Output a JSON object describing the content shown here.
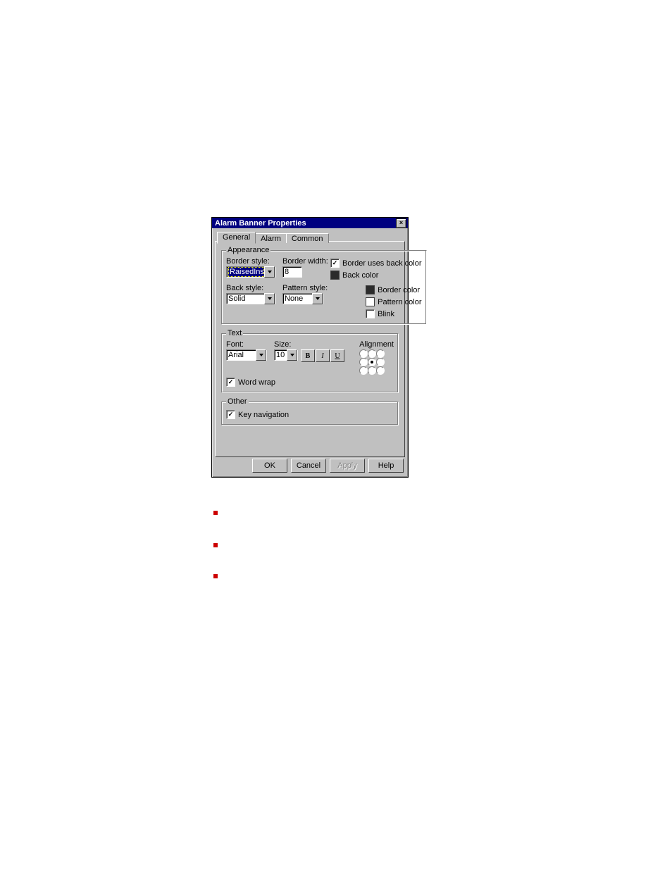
{
  "dialog": {
    "title": "Alarm Banner Properties",
    "tabs": [
      "General",
      "Alarm",
      "Common"
    ],
    "active_tab": 0
  },
  "appearance": {
    "legend": "Appearance",
    "border_style_label": "Border style:",
    "border_style_value": "RaisedInset",
    "border_width_label": "Border width:",
    "border_width_value": "8",
    "back_style_label": "Back style:",
    "back_style_value": "Solid",
    "pattern_style_label": "Pattern style:",
    "pattern_style_value": "None",
    "border_uses_back_label": "Border uses back color",
    "border_uses_back_checked": true,
    "back_color_label": "Back color",
    "back_color": "#2b2b2b",
    "border_color_label": "Border color",
    "border_color": "#2b2b2b",
    "pattern_color_label": "Pattern color",
    "pattern_color": "#ffffff",
    "blink_label": "Blink",
    "blink_checked": false
  },
  "text": {
    "legend": "Text",
    "font_label": "Font:",
    "font_value": "Arial",
    "size_label": "Size:",
    "size_value": "10",
    "bold_glyph": "B",
    "italic_glyph": "I",
    "underline_glyph": "U",
    "wordwrap_label": "Word wrap",
    "wordwrap_checked": true,
    "alignment_label": "Alignment",
    "alignment_selected": 4
  },
  "other": {
    "legend": "Other",
    "keynav_label": "Key navigation",
    "keynav_checked": true
  },
  "buttons": {
    "ok": "OK",
    "cancel": "Cancel",
    "apply": "Apply",
    "help": "Help"
  }
}
